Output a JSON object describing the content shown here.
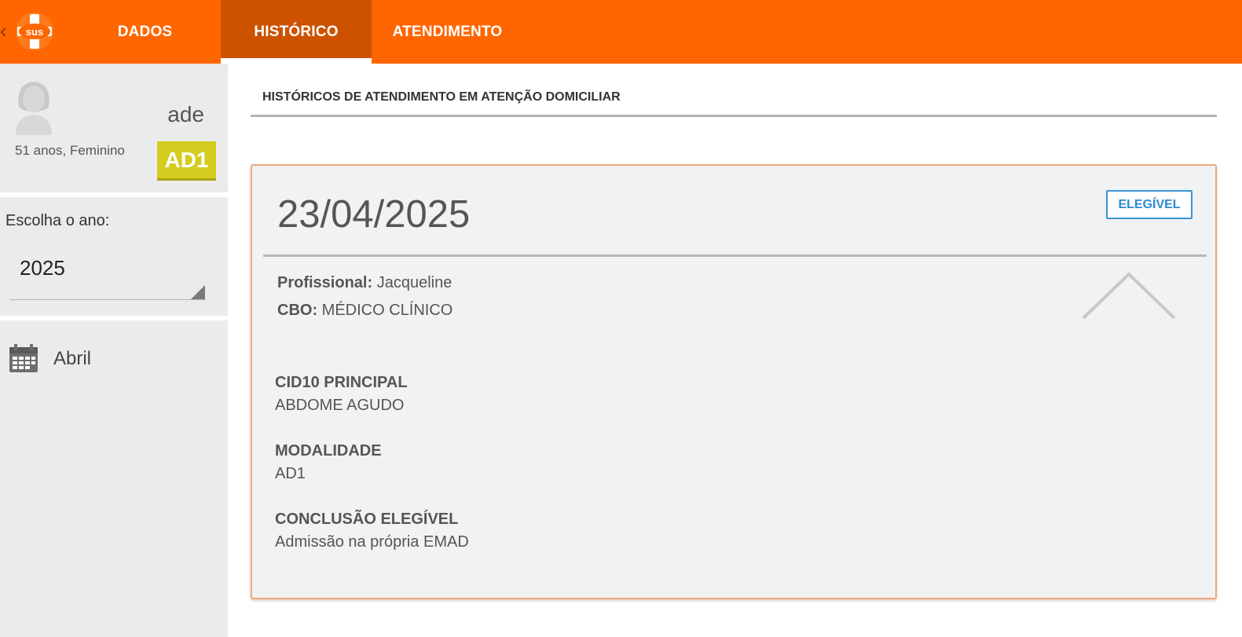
{
  "header": {
    "back_glyph": "‹",
    "logo_text": "sus",
    "tabs": [
      {
        "label": "DADOS"
      },
      {
        "label": "HISTÓRICO"
      },
      {
        "label": "ATENDIMENTO"
      }
    ],
    "accent_color": "#ff6600",
    "active_tab_color": "#cc5200"
  },
  "patient": {
    "name_fragment": "ade",
    "info": "51 anos, Feminino",
    "modality_badge": "AD1",
    "badge_color": "#d4cc1f"
  },
  "filter": {
    "year_label": "Escolha o ano:",
    "year_value": "2025"
  },
  "months": [
    {
      "label": "Abril",
      "icon": "calendar-icon"
    }
  ],
  "main": {
    "section_title": "HISTÓRICOS DE ATENDIMENTO EM ATENÇÃO DOMICILIAR",
    "record": {
      "date": "23/04/2025",
      "status": "ELEGÍVEL",
      "status_color": "#2a8ad2",
      "professional_label": "Profissional:",
      "professional_value": "Jacqueline",
      "cbo_label": "CBO:",
      "cbo_value": "MÉDICO CLÍNICO",
      "fields": [
        {
          "label": "CID10 PRINCIPAL",
          "value": "ABDOME AGUDO"
        },
        {
          "label": "MODALIDADE",
          "value": "AD1"
        },
        {
          "label": "CONCLUSÃO ELEGÍVEL",
          "value": "Admissão na própria EMAD"
        }
      ]
    }
  }
}
